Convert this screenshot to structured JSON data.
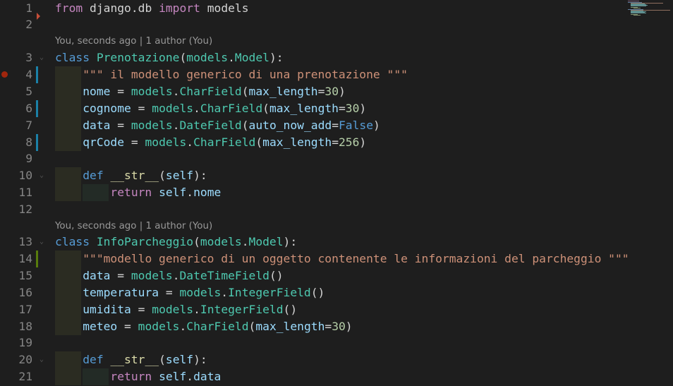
{
  "codelens": {
    "blame_1": "You, seconds ago | 1 author (You)",
    "blame_2": "You, seconds ago | 1 author (You)"
  },
  "lines": [
    {
      "n": "1",
      "tokens": [
        [
          "kw",
          "from"
        ],
        [
          "pl",
          " "
        ],
        [
          "pl",
          "django.db"
        ],
        [
          "pl",
          " "
        ],
        [
          "kw",
          "import"
        ],
        [
          "pl",
          " "
        ],
        [
          "pl",
          "models"
        ]
      ]
    },
    {
      "n": "2",
      "tokens": []
    },
    {
      "n": "3",
      "tokens": [
        [
          "kwb",
          "class"
        ],
        [
          "pl",
          " "
        ],
        [
          "cls",
          "Prenotazione"
        ],
        [
          "pl",
          "("
        ],
        [
          "cls",
          "models"
        ],
        [
          "pl",
          "."
        ],
        [
          "cls",
          "Model"
        ],
        [
          "pl",
          "):"
        ]
      ]
    },
    {
      "n": "4",
      "tokens": [
        [
          "pl",
          "    "
        ],
        [
          "str",
          "\"\"\" il modello generico di una prenotazione \"\"\""
        ]
      ]
    },
    {
      "n": "5",
      "tokens": [
        [
          "pl",
          "    "
        ],
        [
          "var",
          "nome"
        ],
        [
          "pl",
          " = "
        ],
        [
          "cls",
          "models"
        ],
        [
          "pl",
          "."
        ],
        [
          "cls",
          "CharField"
        ],
        [
          "pl",
          "("
        ],
        [
          "var",
          "max_length"
        ],
        [
          "pl",
          "="
        ],
        [
          "num",
          "30"
        ],
        [
          "pl",
          ")"
        ]
      ]
    },
    {
      "n": "6",
      "tokens": [
        [
          "pl",
          "    "
        ],
        [
          "var",
          "cognome"
        ],
        [
          "pl",
          " = "
        ],
        [
          "cls",
          "models"
        ],
        [
          "pl",
          "."
        ],
        [
          "cls",
          "CharField"
        ],
        [
          "pl",
          "("
        ],
        [
          "var",
          "max_length"
        ],
        [
          "pl",
          "="
        ],
        [
          "num",
          "30"
        ],
        [
          "pl",
          ")"
        ]
      ]
    },
    {
      "n": "7",
      "tokens": [
        [
          "pl",
          "    "
        ],
        [
          "var",
          "data"
        ],
        [
          "pl",
          " = "
        ],
        [
          "cls",
          "models"
        ],
        [
          "pl",
          "."
        ],
        [
          "cls",
          "DateField"
        ],
        [
          "pl",
          "("
        ],
        [
          "var",
          "auto_now_add"
        ],
        [
          "pl",
          "="
        ],
        [
          "kwb",
          "False"
        ],
        [
          "pl",
          ")"
        ]
      ]
    },
    {
      "n": "8",
      "tokens": [
        [
          "pl",
          "    "
        ],
        [
          "var",
          "qrCode"
        ],
        [
          "pl",
          " = "
        ],
        [
          "cls",
          "models"
        ],
        [
          "pl",
          "."
        ],
        [
          "cls",
          "CharField"
        ],
        [
          "pl",
          "("
        ],
        [
          "var",
          "max_length"
        ],
        [
          "pl",
          "="
        ],
        [
          "num",
          "256"
        ],
        [
          "pl",
          ")"
        ]
      ]
    },
    {
      "n": "9",
      "tokens": []
    },
    {
      "n": "10",
      "tokens": [
        [
          "pl",
          "    "
        ],
        [
          "kwb",
          "def"
        ],
        [
          "pl",
          " "
        ],
        [
          "fn",
          "__str__"
        ],
        [
          "pl",
          "("
        ],
        [
          "var",
          "self"
        ],
        [
          "pl",
          "):"
        ]
      ]
    },
    {
      "n": "11",
      "tokens": [
        [
          "pl",
          "        "
        ],
        [
          "kw",
          "return"
        ],
        [
          "pl",
          " "
        ],
        [
          "var",
          "self"
        ],
        [
          "pl",
          "."
        ],
        [
          "var",
          "nome"
        ]
      ]
    },
    {
      "n": "12",
      "tokens": []
    },
    {
      "n": "13",
      "tokens": [
        [
          "kwb",
          "class"
        ],
        [
          "pl",
          " "
        ],
        [
          "cls",
          "InfoParcheggio"
        ],
        [
          "pl",
          "("
        ],
        [
          "cls",
          "models"
        ],
        [
          "pl",
          "."
        ],
        [
          "cls",
          "Model"
        ],
        [
          "pl",
          "):"
        ]
      ]
    },
    {
      "n": "14",
      "tokens": [
        [
          "pl",
          "    "
        ],
        [
          "str",
          "\"\"\"modello generico di un oggetto contenente le informazioni del parcheggio \"\"\""
        ]
      ]
    },
    {
      "n": "15",
      "tokens": [
        [
          "pl",
          "    "
        ],
        [
          "var",
          "data"
        ],
        [
          "pl",
          " = "
        ],
        [
          "cls",
          "models"
        ],
        [
          "pl",
          "."
        ],
        [
          "cls",
          "DateTimeField"
        ],
        [
          "pl",
          "()"
        ]
      ]
    },
    {
      "n": "16",
      "tokens": [
        [
          "pl",
          "    "
        ],
        [
          "var",
          "temperatura"
        ],
        [
          "pl",
          " = "
        ],
        [
          "cls",
          "models"
        ],
        [
          "pl",
          "."
        ],
        [
          "cls",
          "IntegerField"
        ],
        [
          "pl",
          "()"
        ]
      ]
    },
    {
      "n": "17",
      "tokens": [
        [
          "pl",
          "    "
        ],
        [
          "var",
          "umidita"
        ],
        [
          "pl",
          " = "
        ],
        [
          "cls",
          "models"
        ],
        [
          "pl",
          "."
        ],
        [
          "cls",
          "IntegerField"
        ],
        [
          "pl",
          "()"
        ]
      ]
    },
    {
      "n": "18",
      "tokens": [
        [
          "pl",
          "    "
        ],
        [
          "var",
          "meteo"
        ],
        [
          "pl",
          " = "
        ],
        [
          "cls",
          "models"
        ],
        [
          "pl",
          "."
        ],
        [
          "cls",
          "CharField"
        ],
        [
          "pl",
          "("
        ],
        [
          "var",
          "max_length"
        ],
        [
          "pl",
          "="
        ],
        [
          "num",
          "30"
        ],
        [
          "pl",
          ")"
        ]
      ]
    },
    {
      "n": "19",
      "tokens": []
    },
    {
      "n": "20",
      "tokens": [
        [
          "pl",
          "    "
        ],
        [
          "kwb",
          "def"
        ],
        [
          "pl",
          " "
        ],
        [
          "fn",
          "__str__"
        ],
        [
          "pl",
          "("
        ],
        [
          "var",
          "self"
        ],
        [
          "pl",
          "):"
        ]
      ]
    },
    {
      "n": "21",
      "tokens": [
        [
          "pl",
          "        "
        ],
        [
          "kw",
          "return"
        ],
        [
          "pl",
          " "
        ],
        [
          "var",
          "self"
        ],
        [
          "pl",
          "."
        ],
        [
          "var",
          "data"
        ]
      ]
    }
  ],
  "colors": {
    "background": "#1e1e1e",
    "line_number": "#858585",
    "modified_bar": "#1b81a8",
    "added_bar": "#587c0c",
    "breakpoint": "#a1260d"
  }
}
